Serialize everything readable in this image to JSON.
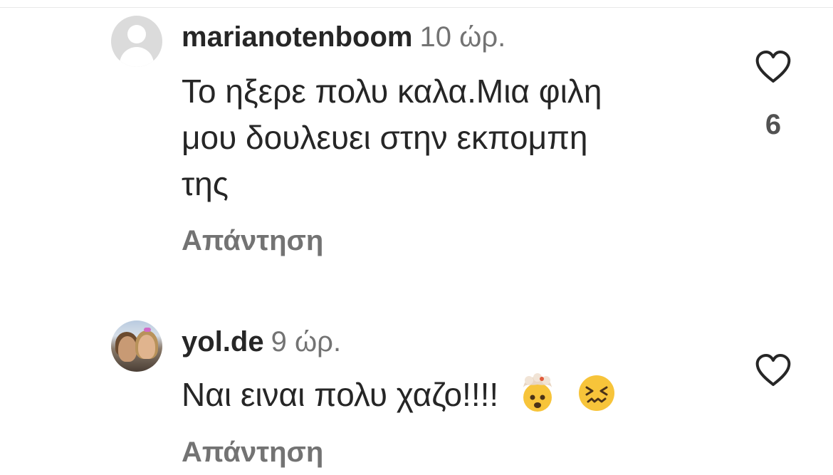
{
  "comments": [
    {
      "username": "marianotenboom",
      "time": "10 ώρ.",
      "text": "Το ηξερε πολυ καλα.Μια φιλη\nμου δουλευει στην εκπομπη\nτης",
      "reply_label": "Απάντηση",
      "like_count": "6",
      "avatar": "default-avatar-icon",
      "like_icon": "heart-outline-icon"
    },
    {
      "username": "yol.de",
      "time": "9 ώρ.",
      "text": "Ναι ειναι πολυ χαζο!!!!",
      "emojis": [
        "exploding-head-emoji",
        "confounded-face-emoji"
      ],
      "reply_label": "Απάντηση",
      "avatar": "profile-photo",
      "like_icon": "heart-outline-icon"
    }
  ],
  "colors": {
    "text_primary": "#262626",
    "text_secondary": "#737373",
    "avatar_placeholder": "#dbdbdb"
  }
}
